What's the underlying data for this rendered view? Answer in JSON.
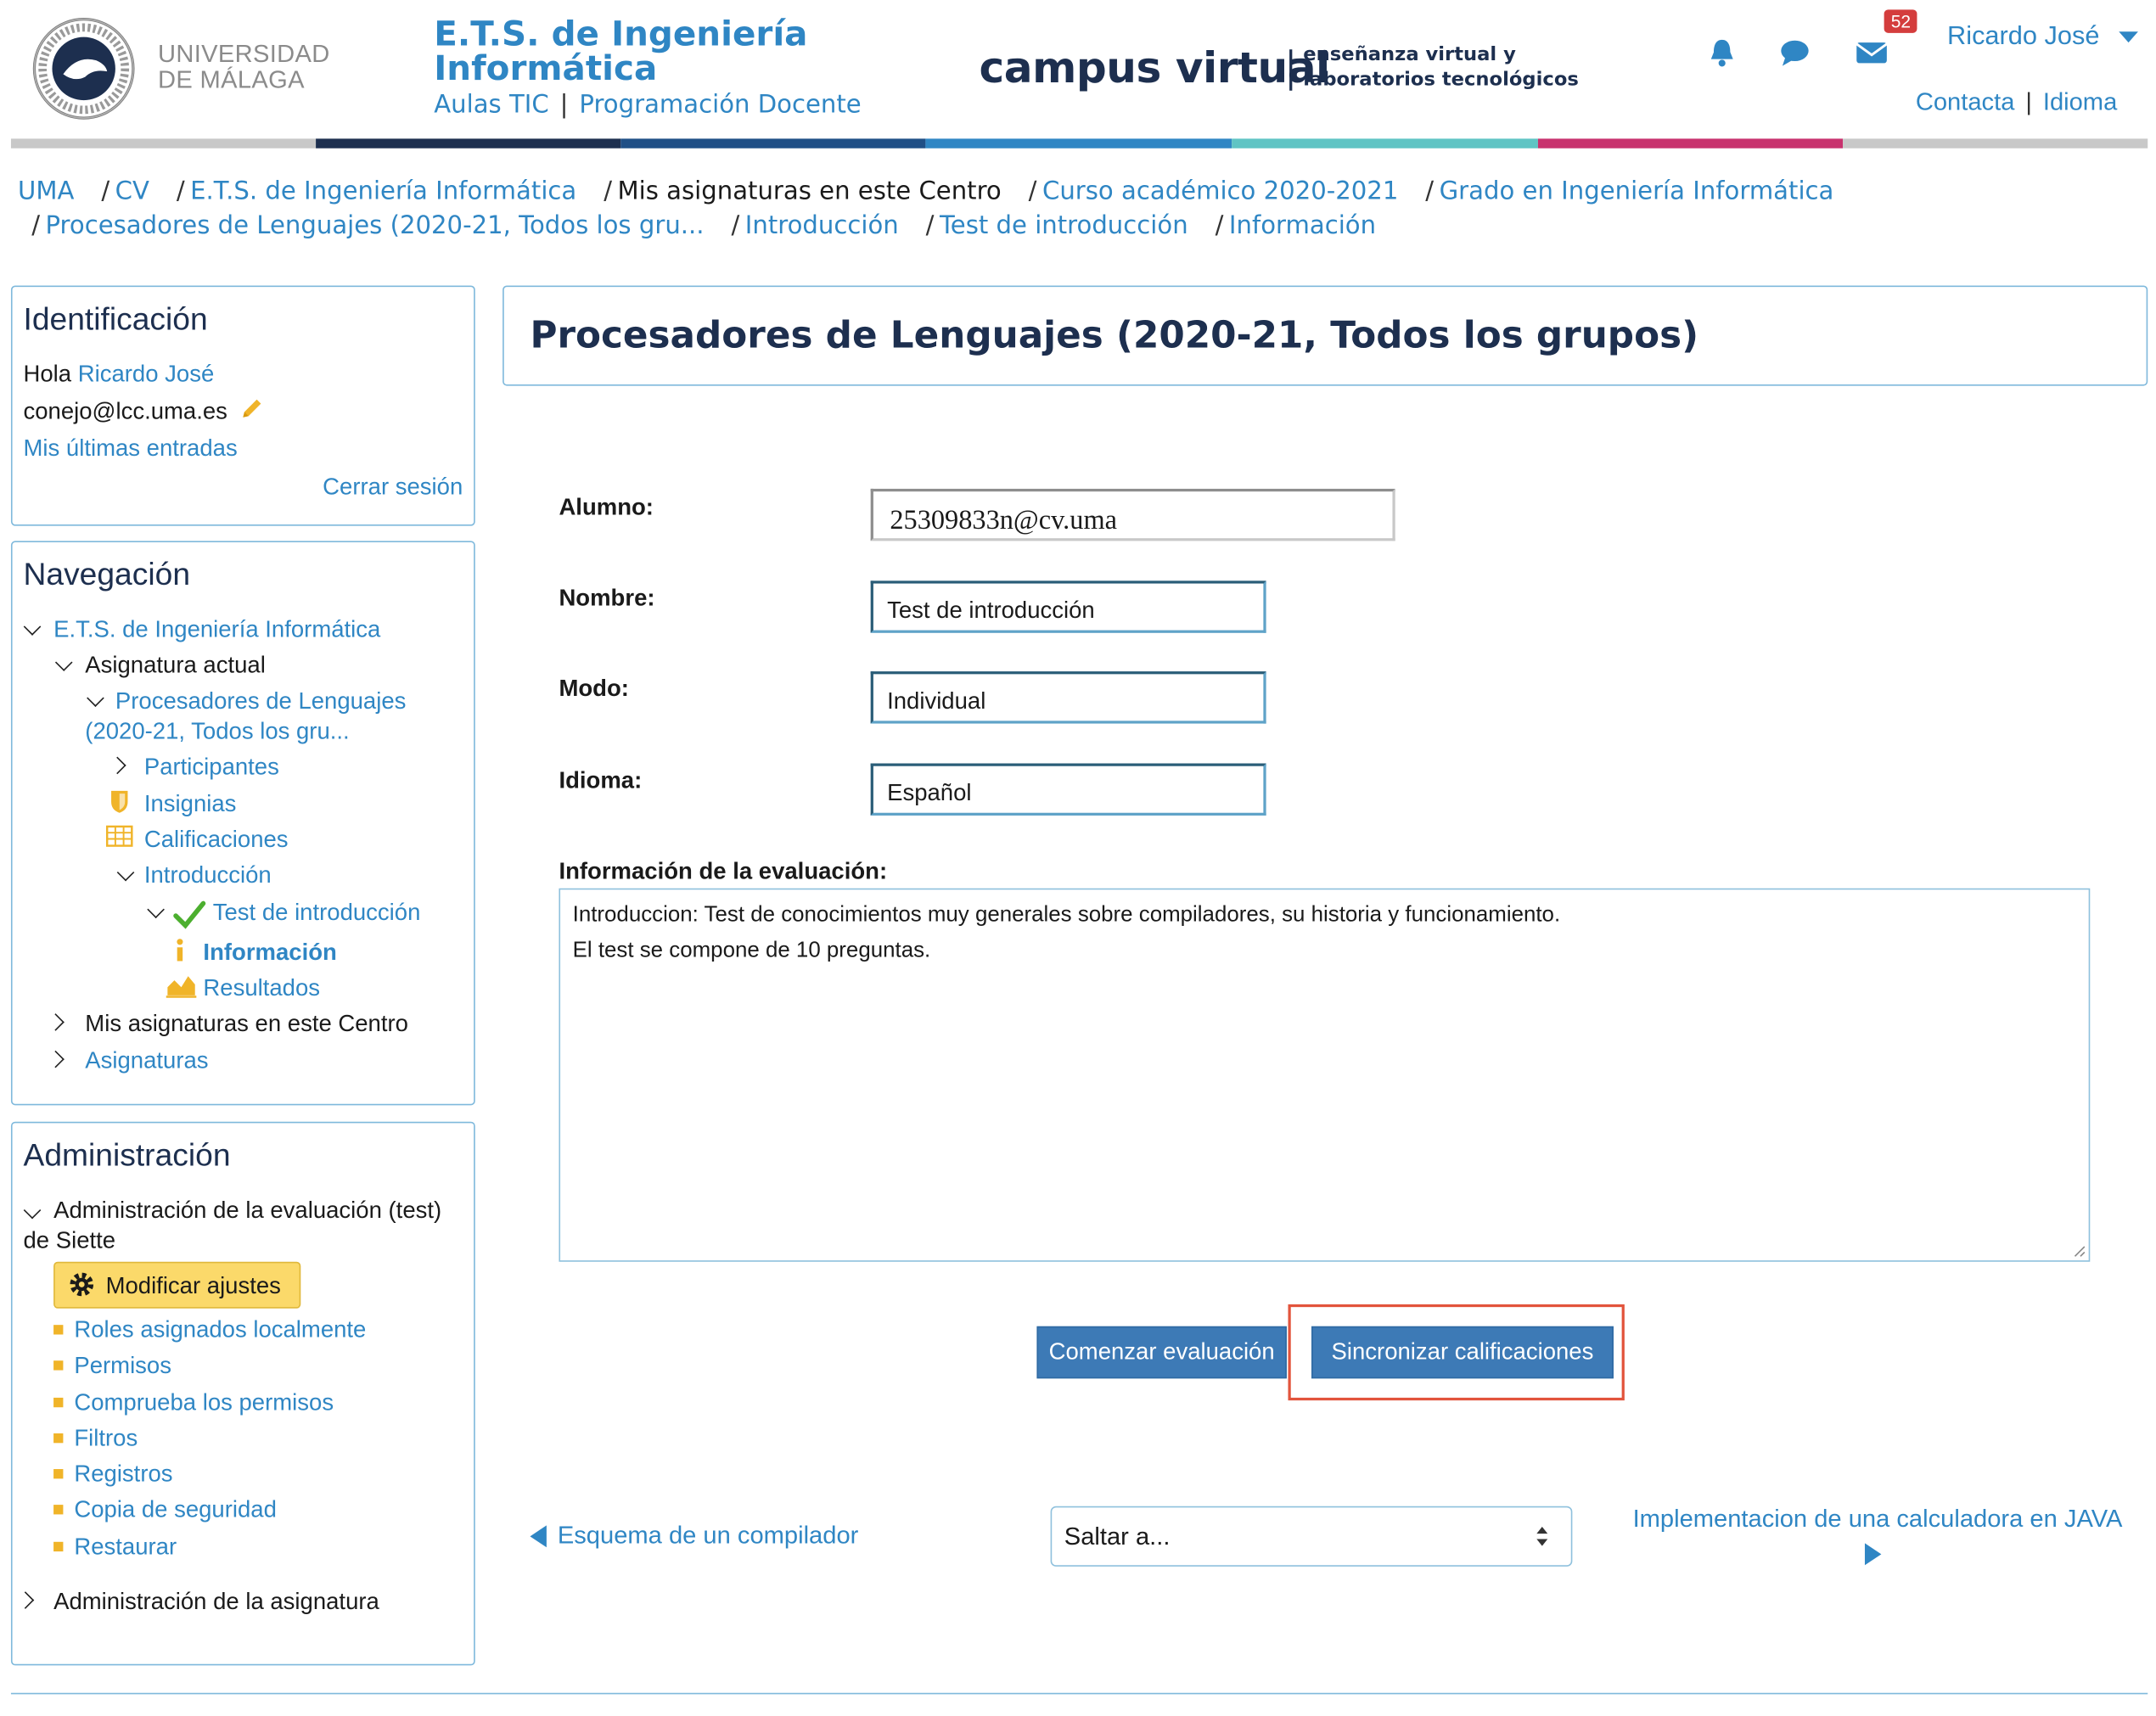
{
  "header": {
    "uma_line1": "UNIVERSIDAD",
    "uma_line2": "DE MÁLAGA",
    "ets_line1": "E.T.S. de Ingeniería",
    "ets_line2": "Informática",
    "ets_link1": "Aulas TIC",
    "ets_link2": "Programación Docente",
    "campus": "campus virtual",
    "campus_sub1": "enseñanza virtual y",
    "campus_sub2": "laboratorios tecnológicos",
    "badge_count": "52",
    "user_name": "Ricardo José",
    "link_contact": "Contacta",
    "link_language": "Idioma",
    "colors": [
      "#1d2f4f",
      "#1f4f86",
      "#2f86c4",
      "#5fc4c4",
      "#c8326e"
    ]
  },
  "breadcrumb": [
    {
      "label": "UMA",
      "current": false
    },
    {
      "label": "CV",
      "current": false
    },
    {
      "label": "E.T.S. de Ingeniería Informática",
      "current": false
    },
    {
      "label": "Mis asignaturas en este Centro",
      "current": true
    },
    {
      "label": "Curso académico 2020-2021",
      "current": false
    },
    {
      "label": "Grado en Ingeniería Informática",
      "current": false
    },
    {
      "label": "Procesadores de Lenguajes (2020-21, Todos los gru...",
      "current": false
    },
    {
      "label": "Introducción",
      "current": false
    },
    {
      "label": "Test de introducción",
      "current": false
    },
    {
      "label": "Información",
      "current": false
    }
  ],
  "identificacion": {
    "title": "Identificación",
    "hola": "Hola",
    "user": "Ricardo José",
    "email": "conejo@lcc.uma.es",
    "last_entries": "Mis últimas entradas",
    "logout": "Cerrar sesión"
  },
  "navegacion": {
    "title": "Navegación",
    "ets": "E.T.S. de Ingeniería Informática",
    "current_course": "Asignatura actual",
    "course_line1": "Procesadores de Lenguajes",
    "course_line2": "(2020-21, Todos los gru...",
    "participants": "Participantes",
    "badges": "Insignias",
    "grades": "Calificaciones",
    "intro": "Introducción",
    "test": "Test de introducción",
    "info": "Información",
    "results": "Resultados",
    "my_courses": "Mis asignaturas en este Centro",
    "courses": "Asignaturas"
  },
  "administracion": {
    "title": "Administración",
    "quiz_admin_line1": "Administración de la evaluación (test)",
    "quiz_admin_line2": "de Siette",
    "modify": "Modificar ajustes",
    "items": [
      "Roles asignados localmente",
      "Permisos",
      "Comprueba los permisos",
      "Filtros",
      "Registros",
      "Copia de seguridad",
      "Restaurar"
    ],
    "course_admin": "Administración de la asignatura"
  },
  "main": {
    "title": "Procesadores de Lenguajes (2020-21, Todos los grupos)",
    "alumno_label": "Alumno:",
    "alumno_value": "25309833n@cv.uma",
    "nombre_label": "Nombre:",
    "nombre_value": "Test de introducción",
    "modo_label": "Modo:",
    "modo_value": "Individual",
    "idioma_label": "Idioma:",
    "idioma_value": "Español",
    "info_label": "Información de la evaluación:",
    "info_line1": "Introduccion: Test de conocimientos muy generales sobre compiladores, su historia y funcionamiento.",
    "info_line2": "El test se compone de 10 preguntas.",
    "btn_start": "Comenzar evaluación",
    "btn_sync": "Sincronizar calificaciones",
    "prev_link": "Esquema de un compilador",
    "jump_select": "Saltar a...",
    "next_link": "Implementacion de una calculadora en JAVA"
  }
}
